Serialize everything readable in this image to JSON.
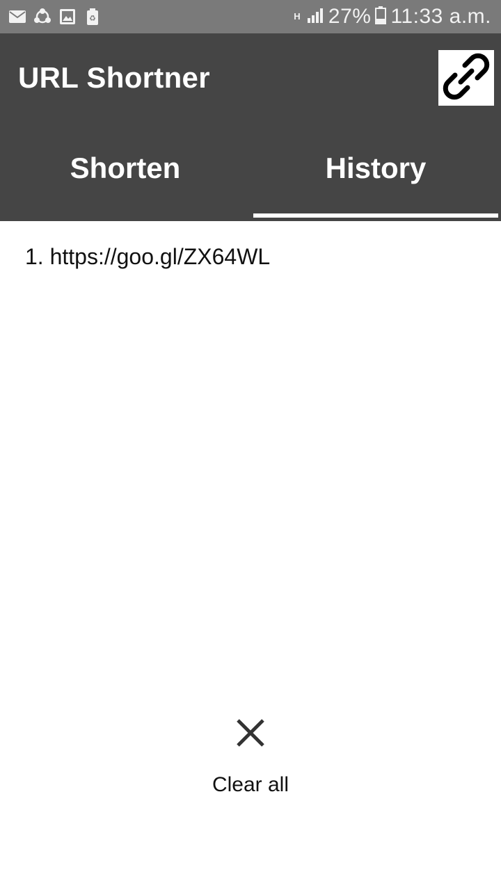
{
  "status_bar": {
    "left_icons": [
      "mail-icon",
      "share-icon",
      "image-icon",
      "recycle-icon"
    ],
    "network_type": "H",
    "battery_percent": "27%",
    "time": "11:33 a.m."
  },
  "app_bar": {
    "title": "URL Shortner",
    "action_icon": "link-icon"
  },
  "tabs": [
    {
      "label": "Shorten",
      "selected": false
    },
    {
      "label": "History",
      "selected": true
    }
  ],
  "history": {
    "items": [
      {
        "text": "1. https://goo.gl/ZX64WL"
      }
    ]
  },
  "clear_all": {
    "icon": "close-icon",
    "label": "Clear all"
  },
  "colors": {
    "status_bar": "#7a7a7a",
    "app_bar": "#454545",
    "tab_indicator": "#ffffff",
    "background": "#ffffff"
  }
}
